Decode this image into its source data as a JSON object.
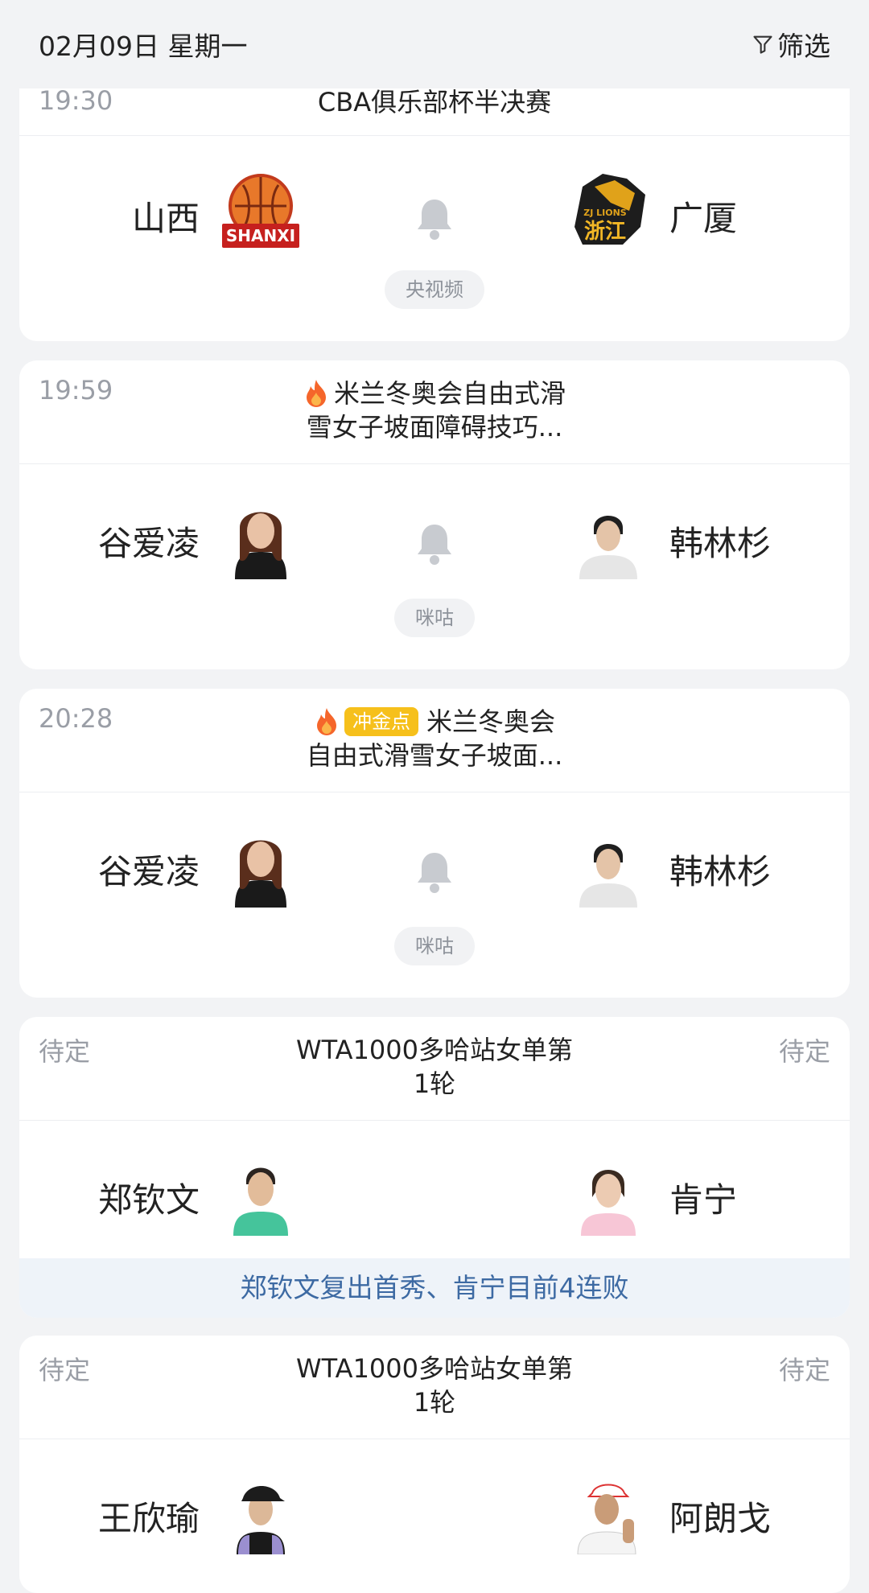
{
  "header": {
    "date": "02月09日 星期一",
    "filter_label": "筛选"
  },
  "cards": [
    {
      "time": "19:30",
      "title": "CBA俱乐部杯半决赛",
      "left_name": "山西",
      "left_logo": "shanxi-team-logo",
      "left_logo_text": "SHANXI",
      "right_name": "广厦",
      "right_logo": "zhejiang-lions-logo",
      "right_logo_text_top": "ZJ LIONS",
      "right_logo_text": "浙江",
      "broadcast": "央视频"
    },
    {
      "time": "19:59",
      "title_line1": "米兰冬奥会自由式滑",
      "title_line2": "雪女子坡面障碍技巧...",
      "left_name": "谷爱凌",
      "right_name": "韩林杉",
      "broadcast": "咪咕"
    },
    {
      "time": "20:28",
      "badge": "冲金点",
      "title_line1": "米兰冬奥会",
      "title_line2": "自由式滑雪女子坡面...",
      "left_name": "谷爱凌",
      "right_name": "韩林杉",
      "broadcast": "咪咕"
    },
    {
      "time_left": "待定",
      "time_right": "待定",
      "title_line1": "WTA1000多哈站女单第",
      "title_line2": "1轮",
      "left_name": "郑钦文",
      "right_name": "肯宁",
      "summary": "郑钦文复出首秀、肯宁目前4连败"
    },
    {
      "time_left": "待定",
      "time_right": "待定",
      "title_line1": "WTA1000多哈站女单第",
      "title_line2": "1轮",
      "left_name": "王欣瑜",
      "right_name": "阿朗戈"
    }
  ],
  "colors": {
    "accent_text": "#3d6aa3",
    "badge": "#f6c01b",
    "fire": "#f5662b"
  }
}
